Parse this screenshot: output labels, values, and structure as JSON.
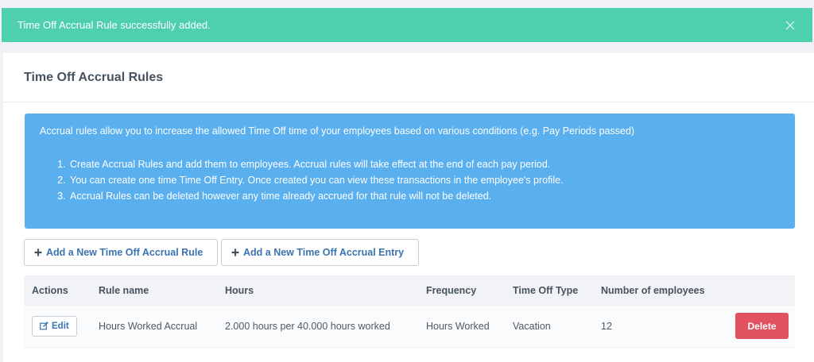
{
  "toast": {
    "message": "Time Off Accrual Rule successfully added.",
    "close_icon": "close-icon"
  },
  "panel": {
    "title": "Time Off Accrual Rules"
  },
  "info": {
    "intro": "Accrual rules allow you to increase the allowed Time Off time of your employees based on various conditions (e.g. Pay Periods passed)",
    "items": [
      "Create Accrual Rules and add them to employees. Accrual rules will take effect at the end of each pay period.",
      "You can create one time Time Off Entry. Once created you can view these transactions in the employee's profile.",
      "Accrual Rules can be deleted however any time already accrued for that rule will not be deleted."
    ]
  },
  "buttons": {
    "add_rule": "Add a New Time Off Accrual Rule",
    "add_entry": "Add a New Time Off Accrual Entry",
    "icon": "plus-icon"
  },
  "table": {
    "headers": [
      "Actions",
      "Rule name",
      "Hours",
      "Frequency",
      "Time Off Type",
      "Number of employees"
    ],
    "rows": [
      {
        "edit_label": "Edit",
        "rule_name": "Hours Worked Accrual",
        "hours": "2.000 hours per 40.000 hours worked",
        "frequency": "Hours Worked",
        "time_off_type": "Vacation",
        "employees": "12",
        "delete_label": "Delete"
      }
    ]
  },
  "colors": {
    "success": "#4ecfad",
    "info": "#5aafee",
    "danger": "#e2515f",
    "link": "#3b73b0"
  }
}
